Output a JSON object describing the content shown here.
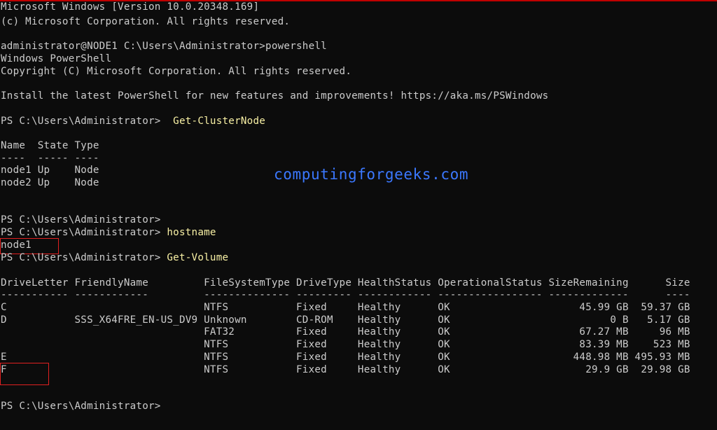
{
  "banner": {
    "version": "Microsoft Windows [Version 10.0.20348.169]",
    "copyright": "(c) Microsoft Corporation. All rights reserved."
  },
  "launch": {
    "prompt": "administrator@NODE1 C:\\Users\\Administrator>",
    "command": "powershell"
  },
  "ps_banner": {
    "title": "Windows PowerShell",
    "copyright": "Copyright (C) Microsoft Corporation. All rights reserved.",
    "install_msg": "Install the latest PowerShell for new features and improvements! https://aka.ms/PSWindows"
  },
  "prompt": "PS C:\\Users\\Administrator>",
  "cmd1": {
    "prompt": "PS C:\\Users\\Administrator>  ",
    "command": "Get-ClusterNode"
  },
  "cluster_table": {
    "header": "Name  State Type",
    "separator": "----  ----- ----",
    "rows": [
      "node1 Up    Node",
      "node2 Up    Node"
    ]
  },
  "watermark": "computingforgeeks.com",
  "cmd2": {
    "empty_prompt": "PS C:\\Users\\Administrator>",
    "prompt": "PS C:\\Users\\Administrator> ",
    "command": "hostname",
    "output": "node1"
  },
  "cmd3": {
    "prompt": "PS C:\\Users\\Administrator> ",
    "command": "Get-Volume"
  },
  "volume_table": {
    "header": "DriveLetter FriendlyName         FileSystemType DriveType HealthStatus OperationalStatus SizeRemaining      Size",
    "separator": "----------- ------------         -------------- --------- ------------ ----------------- -------------      ----",
    "rows": [
      "C                                NTFS           Fixed     Healthy      OK                     45.99 GB  59.37 GB",
      "D           SSS_X64FRE_EN-US_DV9 Unknown        CD-ROM    Healthy      OK                          0 B   5.17 GB",
      "                                 FAT32          Fixed     Healthy      OK                     67.27 MB     96 MB",
      "                                 NTFS           Fixed     Healthy      OK                     83.39 MB    523 MB",
      "E                                NTFS           Fixed     Healthy      OK                    448.98 MB 495.93 MB",
      "F                                NTFS           Fixed     Healthy      OK                      29.9 GB  29.98 GB"
    ]
  },
  "final_prompt": "PS C:\\Users\\Administrator>",
  "colors": {
    "background": "#0c0c0c",
    "text": "#cccccc",
    "command": "#f9f1a5",
    "watermark": "#3b78ff",
    "highlight_box": "#e02020"
  }
}
